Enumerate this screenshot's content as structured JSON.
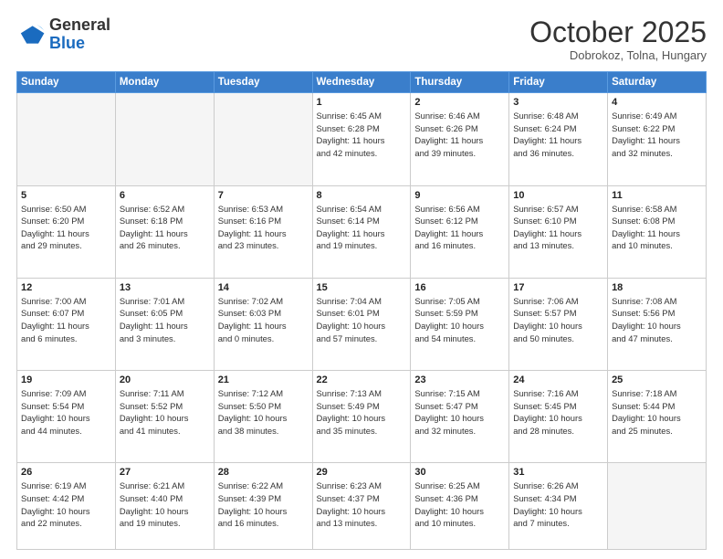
{
  "header": {
    "logo_general": "General",
    "logo_blue": "Blue",
    "month_title": "October 2025",
    "location": "Dobrokoz, Tolna, Hungary"
  },
  "days_of_week": [
    "Sunday",
    "Monday",
    "Tuesday",
    "Wednesday",
    "Thursday",
    "Friday",
    "Saturday"
  ],
  "weeks": [
    [
      {
        "day": "",
        "info": ""
      },
      {
        "day": "",
        "info": ""
      },
      {
        "day": "",
        "info": ""
      },
      {
        "day": "1",
        "info": "Sunrise: 6:45 AM\nSunset: 6:28 PM\nDaylight: 11 hours\nand 42 minutes."
      },
      {
        "day": "2",
        "info": "Sunrise: 6:46 AM\nSunset: 6:26 PM\nDaylight: 11 hours\nand 39 minutes."
      },
      {
        "day": "3",
        "info": "Sunrise: 6:48 AM\nSunset: 6:24 PM\nDaylight: 11 hours\nand 36 minutes."
      },
      {
        "day": "4",
        "info": "Sunrise: 6:49 AM\nSunset: 6:22 PM\nDaylight: 11 hours\nand 32 minutes."
      }
    ],
    [
      {
        "day": "5",
        "info": "Sunrise: 6:50 AM\nSunset: 6:20 PM\nDaylight: 11 hours\nand 29 minutes."
      },
      {
        "day": "6",
        "info": "Sunrise: 6:52 AM\nSunset: 6:18 PM\nDaylight: 11 hours\nand 26 minutes."
      },
      {
        "day": "7",
        "info": "Sunrise: 6:53 AM\nSunset: 6:16 PM\nDaylight: 11 hours\nand 23 minutes."
      },
      {
        "day": "8",
        "info": "Sunrise: 6:54 AM\nSunset: 6:14 PM\nDaylight: 11 hours\nand 19 minutes."
      },
      {
        "day": "9",
        "info": "Sunrise: 6:56 AM\nSunset: 6:12 PM\nDaylight: 11 hours\nand 16 minutes."
      },
      {
        "day": "10",
        "info": "Sunrise: 6:57 AM\nSunset: 6:10 PM\nDaylight: 11 hours\nand 13 minutes."
      },
      {
        "day": "11",
        "info": "Sunrise: 6:58 AM\nSunset: 6:08 PM\nDaylight: 11 hours\nand 10 minutes."
      }
    ],
    [
      {
        "day": "12",
        "info": "Sunrise: 7:00 AM\nSunset: 6:07 PM\nDaylight: 11 hours\nand 6 minutes."
      },
      {
        "day": "13",
        "info": "Sunrise: 7:01 AM\nSunset: 6:05 PM\nDaylight: 11 hours\nand 3 minutes."
      },
      {
        "day": "14",
        "info": "Sunrise: 7:02 AM\nSunset: 6:03 PM\nDaylight: 11 hours\nand 0 minutes."
      },
      {
        "day": "15",
        "info": "Sunrise: 7:04 AM\nSunset: 6:01 PM\nDaylight: 10 hours\nand 57 minutes."
      },
      {
        "day": "16",
        "info": "Sunrise: 7:05 AM\nSunset: 5:59 PM\nDaylight: 10 hours\nand 54 minutes."
      },
      {
        "day": "17",
        "info": "Sunrise: 7:06 AM\nSunset: 5:57 PM\nDaylight: 10 hours\nand 50 minutes."
      },
      {
        "day": "18",
        "info": "Sunrise: 7:08 AM\nSunset: 5:56 PM\nDaylight: 10 hours\nand 47 minutes."
      }
    ],
    [
      {
        "day": "19",
        "info": "Sunrise: 7:09 AM\nSunset: 5:54 PM\nDaylight: 10 hours\nand 44 minutes."
      },
      {
        "day": "20",
        "info": "Sunrise: 7:11 AM\nSunset: 5:52 PM\nDaylight: 10 hours\nand 41 minutes."
      },
      {
        "day": "21",
        "info": "Sunrise: 7:12 AM\nSunset: 5:50 PM\nDaylight: 10 hours\nand 38 minutes."
      },
      {
        "day": "22",
        "info": "Sunrise: 7:13 AM\nSunset: 5:49 PM\nDaylight: 10 hours\nand 35 minutes."
      },
      {
        "day": "23",
        "info": "Sunrise: 7:15 AM\nSunset: 5:47 PM\nDaylight: 10 hours\nand 32 minutes."
      },
      {
        "day": "24",
        "info": "Sunrise: 7:16 AM\nSunset: 5:45 PM\nDaylight: 10 hours\nand 28 minutes."
      },
      {
        "day": "25",
        "info": "Sunrise: 7:18 AM\nSunset: 5:44 PM\nDaylight: 10 hours\nand 25 minutes."
      }
    ],
    [
      {
        "day": "26",
        "info": "Sunrise: 6:19 AM\nSunset: 4:42 PM\nDaylight: 10 hours\nand 22 minutes."
      },
      {
        "day": "27",
        "info": "Sunrise: 6:21 AM\nSunset: 4:40 PM\nDaylight: 10 hours\nand 19 minutes."
      },
      {
        "day": "28",
        "info": "Sunrise: 6:22 AM\nSunset: 4:39 PM\nDaylight: 10 hours\nand 16 minutes."
      },
      {
        "day": "29",
        "info": "Sunrise: 6:23 AM\nSunset: 4:37 PM\nDaylight: 10 hours\nand 13 minutes."
      },
      {
        "day": "30",
        "info": "Sunrise: 6:25 AM\nSunset: 4:36 PM\nDaylight: 10 hours\nand 10 minutes."
      },
      {
        "day": "31",
        "info": "Sunrise: 6:26 AM\nSunset: 4:34 PM\nDaylight: 10 hours\nand 7 minutes."
      },
      {
        "day": "",
        "info": ""
      }
    ]
  ]
}
